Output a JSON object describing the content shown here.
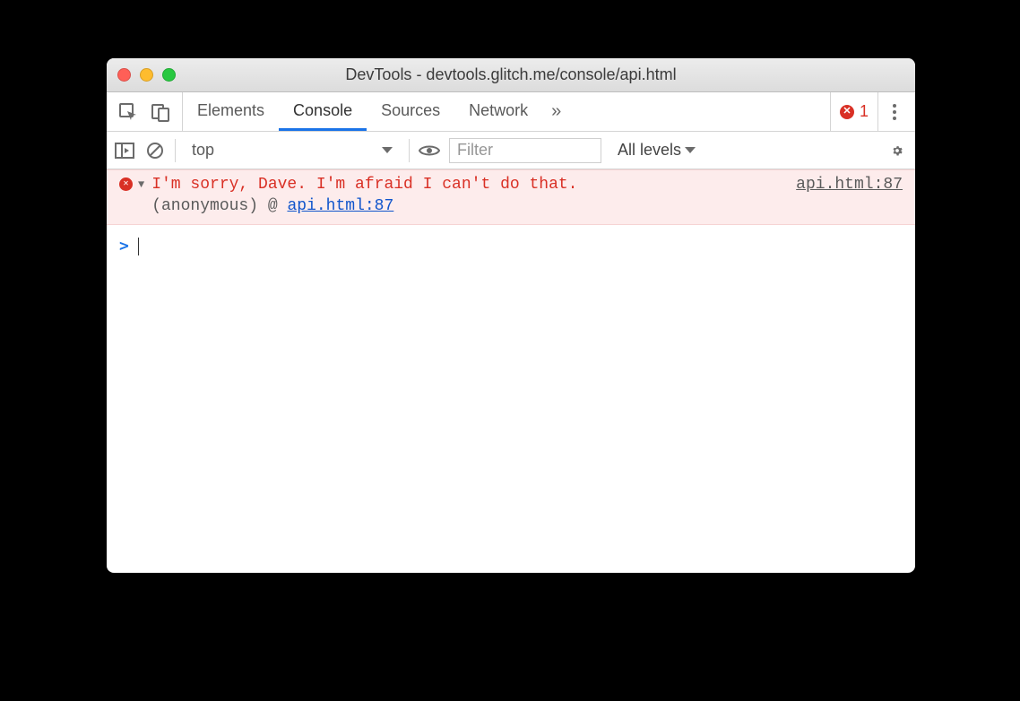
{
  "window": {
    "title": "DevTools - devtools.glitch.me/console/api.html"
  },
  "tabs": {
    "items": [
      "Elements",
      "Console",
      "Sources",
      "Network"
    ],
    "active_index": 1,
    "more_glyph": "»"
  },
  "error_counter": {
    "count": "1"
  },
  "console_toolbar": {
    "context": "top",
    "filter_placeholder": "Filter",
    "levels_label": "All levels"
  },
  "log": {
    "error": {
      "message": "I'm sorry, Dave. I'm afraid I can't do that.",
      "source_link": "api.html:87",
      "trace_label": "(anonymous)",
      "trace_at": "@",
      "trace_link": "api.html:87"
    }
  },
  "prompt": {
    "caret": ">",
    "value": ""
  }
}
